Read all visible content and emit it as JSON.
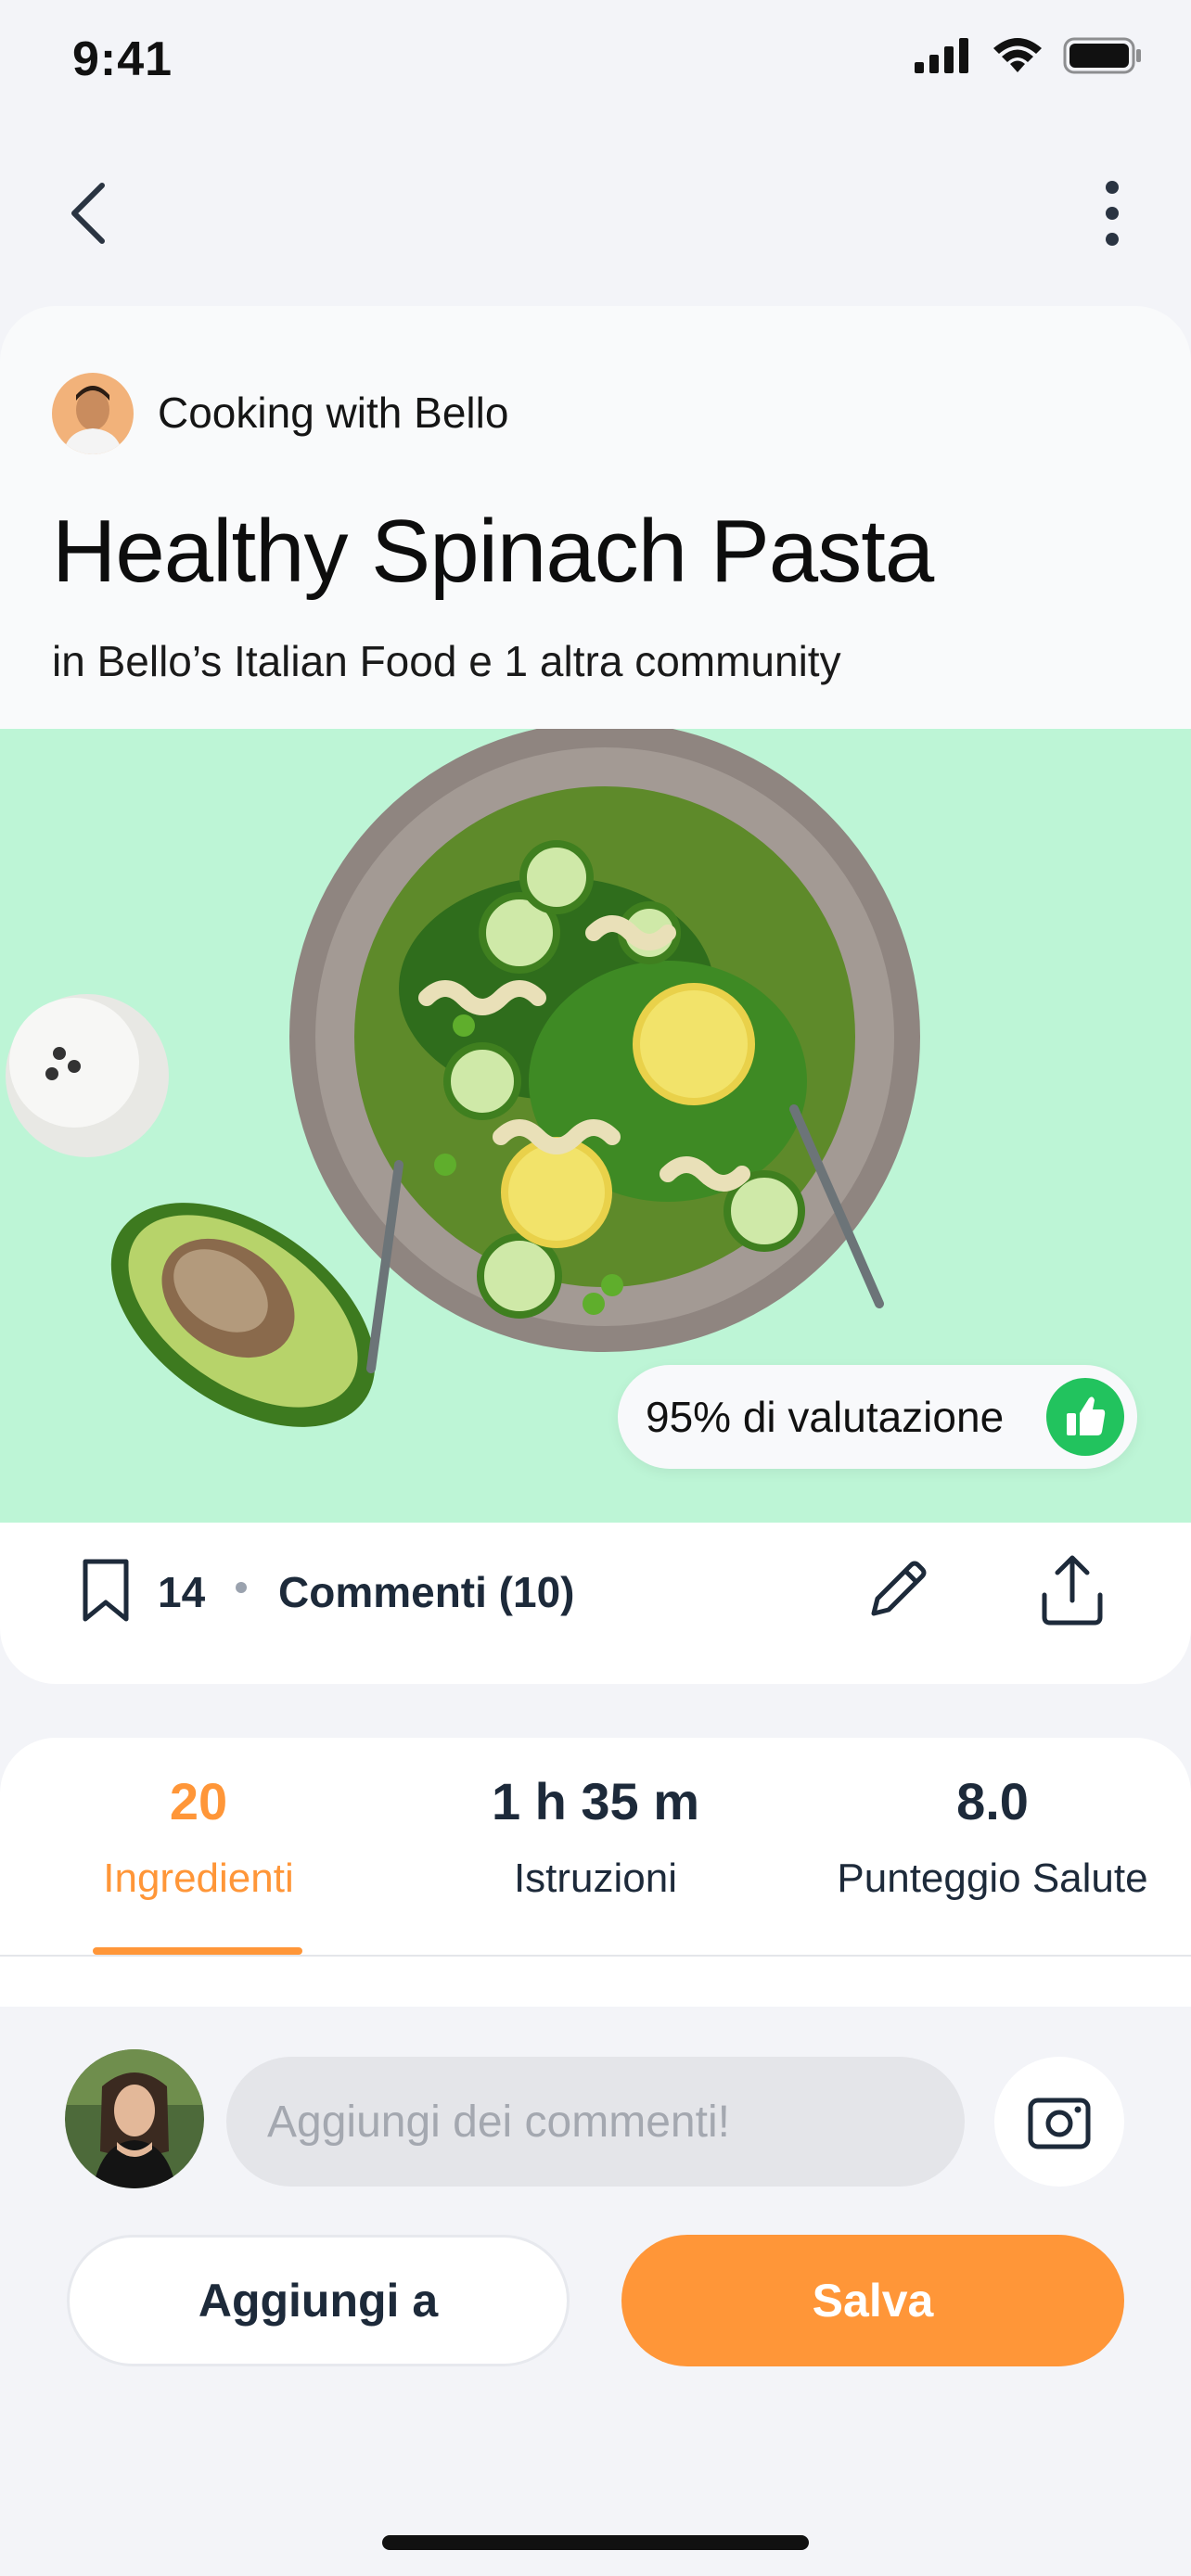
{
  "status_bar": {
    "time": "9:41"
  },
  "author": {
    "name": "Cooking with Bello"
  },
  "recipe": {
    "title": "Healthy Spinach Pasta",
    "subtitle": "in Bello’s Italian Food e 1 altra community"
  },
  "hero": {
    "rating_label": "95% di valutazione",
    "background": "#bdf5d6"
  },
  "actions": {
    "bookmarks": "14",
    "comments_label": "Commenti (10)"
  },
  "tabs": [
    {
      "value": "20",
      "label": "Ingredienti",
      "active": true
    },
    {
      "value": "1 h 35 m",
      "label": "Istruzioni",
      "active": false
    },
    {
      "value": "8.0",
      "label": "Punteggio Salute",
      "active": false
    }
  ],
  "comment": {
    "placeholder": "Aggiungi dei commenti!"
  },
  "buttons": {
    "add_to": "Aggiungi a",
    "save": "Salva"
  },
  "colors": {
    "accent": "#ff9638",
    "rating_green": "#22c35e",
    "text_dark": "#1d2a3a"
  },
  "icons": [
    "back-icon",
    "more-vertical-icon",
    "bookmark-icon",
    "edit-icon",
    "share-icon",
    "thumbs-up-icon",
    "camera-icon"
  ]
}
